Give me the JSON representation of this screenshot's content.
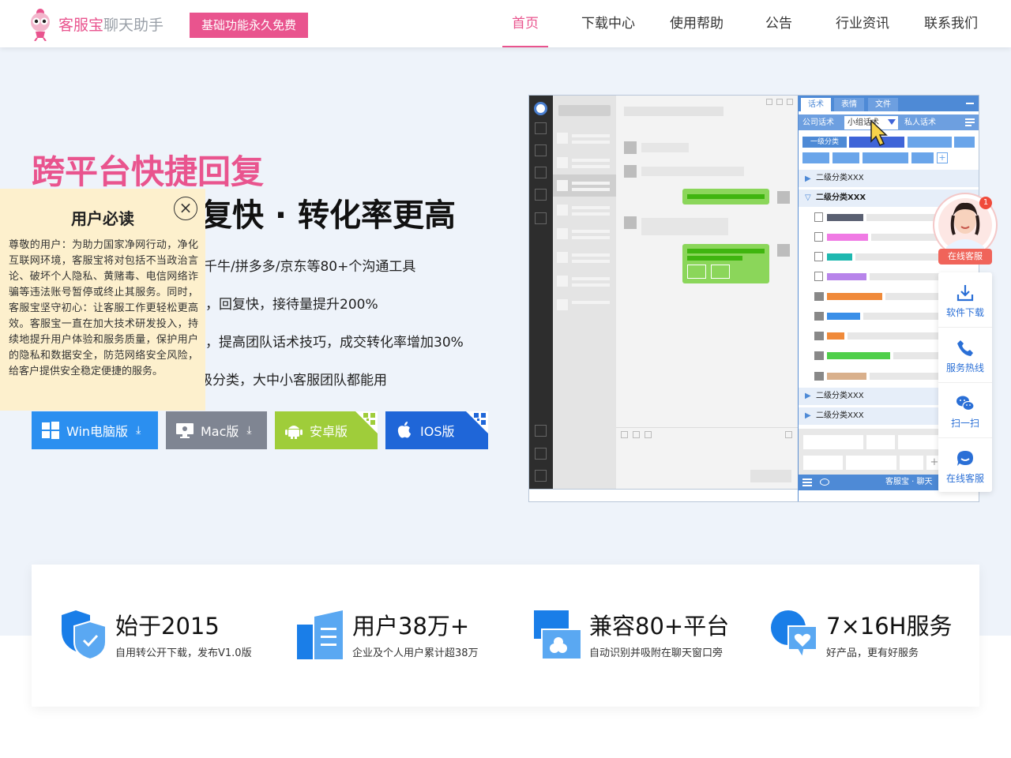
{
  "header": {
    "brand_main": "客服宝",
    "brand_sub": "聊天助手",
    "badge": "基础功能永久免费",
    "nav": [
      {
        "label": "首页",
        "active": true
      },
      {
        "label": "下载中心",
        "active": false
      },
      {
        "label": "使用帮助",
        "active": false
      },
      {
        "label": "公告",
        "active": false
      },
      {
        "label": "行业资讯",
        "active": false
      },
      {
        "label": "联系我们",
        "active": false
      }
    ]
  },
  "hero": {
    "title": "跨平台快捷回复",
    "subtitle_visible": "复快 · 转化率更高",
    "features": [
      "千牛/拼多多/京东等80+个沟通工具",
      "，回复快，接待量提升200%",
      "，提高团队话术技巧，成交转化率增加30%",
      "级分类，大中小客服团队都能用"
    ],
    "downloads": [
      {
        "label": "Win电脑版",
        "color": "#2b8ff0"
      },
      {
        "label": "Mac版",
        "color": "#7f8592"
      },
      {
        "label": "安卓版",
        "color": "#9fcd3a"
      },
      {
        "label": "IOS版",
        "color": "#1f66d8"
      }
    ]
  },
  "notice": {
    "title": "用户必读",
    "close": "×",
    "body": "尊敬的用户：为助力国家净网行动，净化互联网环境，客服宝将对包括不当政治言论、破坏个人隐私、黄赌毒、电信网络诈骗等违法账号暂停或终止其服务。同时，客服宝坚守初心：让客服工作更轻松更高效。客服宝一直在加大技术研发投入，持续地提升用户体验和服务质量，保护用户的隐私和数据安全，防范网络安全风险，给客户提供安全稳定便捷的服务。"
  },
  "mockup": {
    "tabs": [
      "话术",
      "表情",
      "文件"
    ],
    "subtabs": [
      "公司话术",
      "小组话术",
      "私人话术"
    ],
    "level1": "一级分类",
    "add": "+",
    "categories": [
      "二级分类XXX",
      "二级分类XXX",
      "二级分类XXX",
      "二级分类XXX"
    ],
    "footer": "客服宝 · 聊天"
  },
  "cs": {
    "online_badge": "在线客服",
    "count": "1",
    "items": [
      "软件下载",
      "服务热线",
      "扫一扫",
      "在线客服"
    ]
  },
  "stats": [
    {
      "title": "始于2015",
      "desc": "自用转公开下载，发布V1.0版"
    },
    {
      "title": "用户38万+",
      "desc": "企业及个人用户累计超38万"
    },
    {
      "title": "兼容80+平台",
      "desc": "自动识别并吸附在聊天窗口旁"
    },
    {
      "title": "7×16H服务",
      "desc": "好产品，更有好服务"
    }
  ]
}
